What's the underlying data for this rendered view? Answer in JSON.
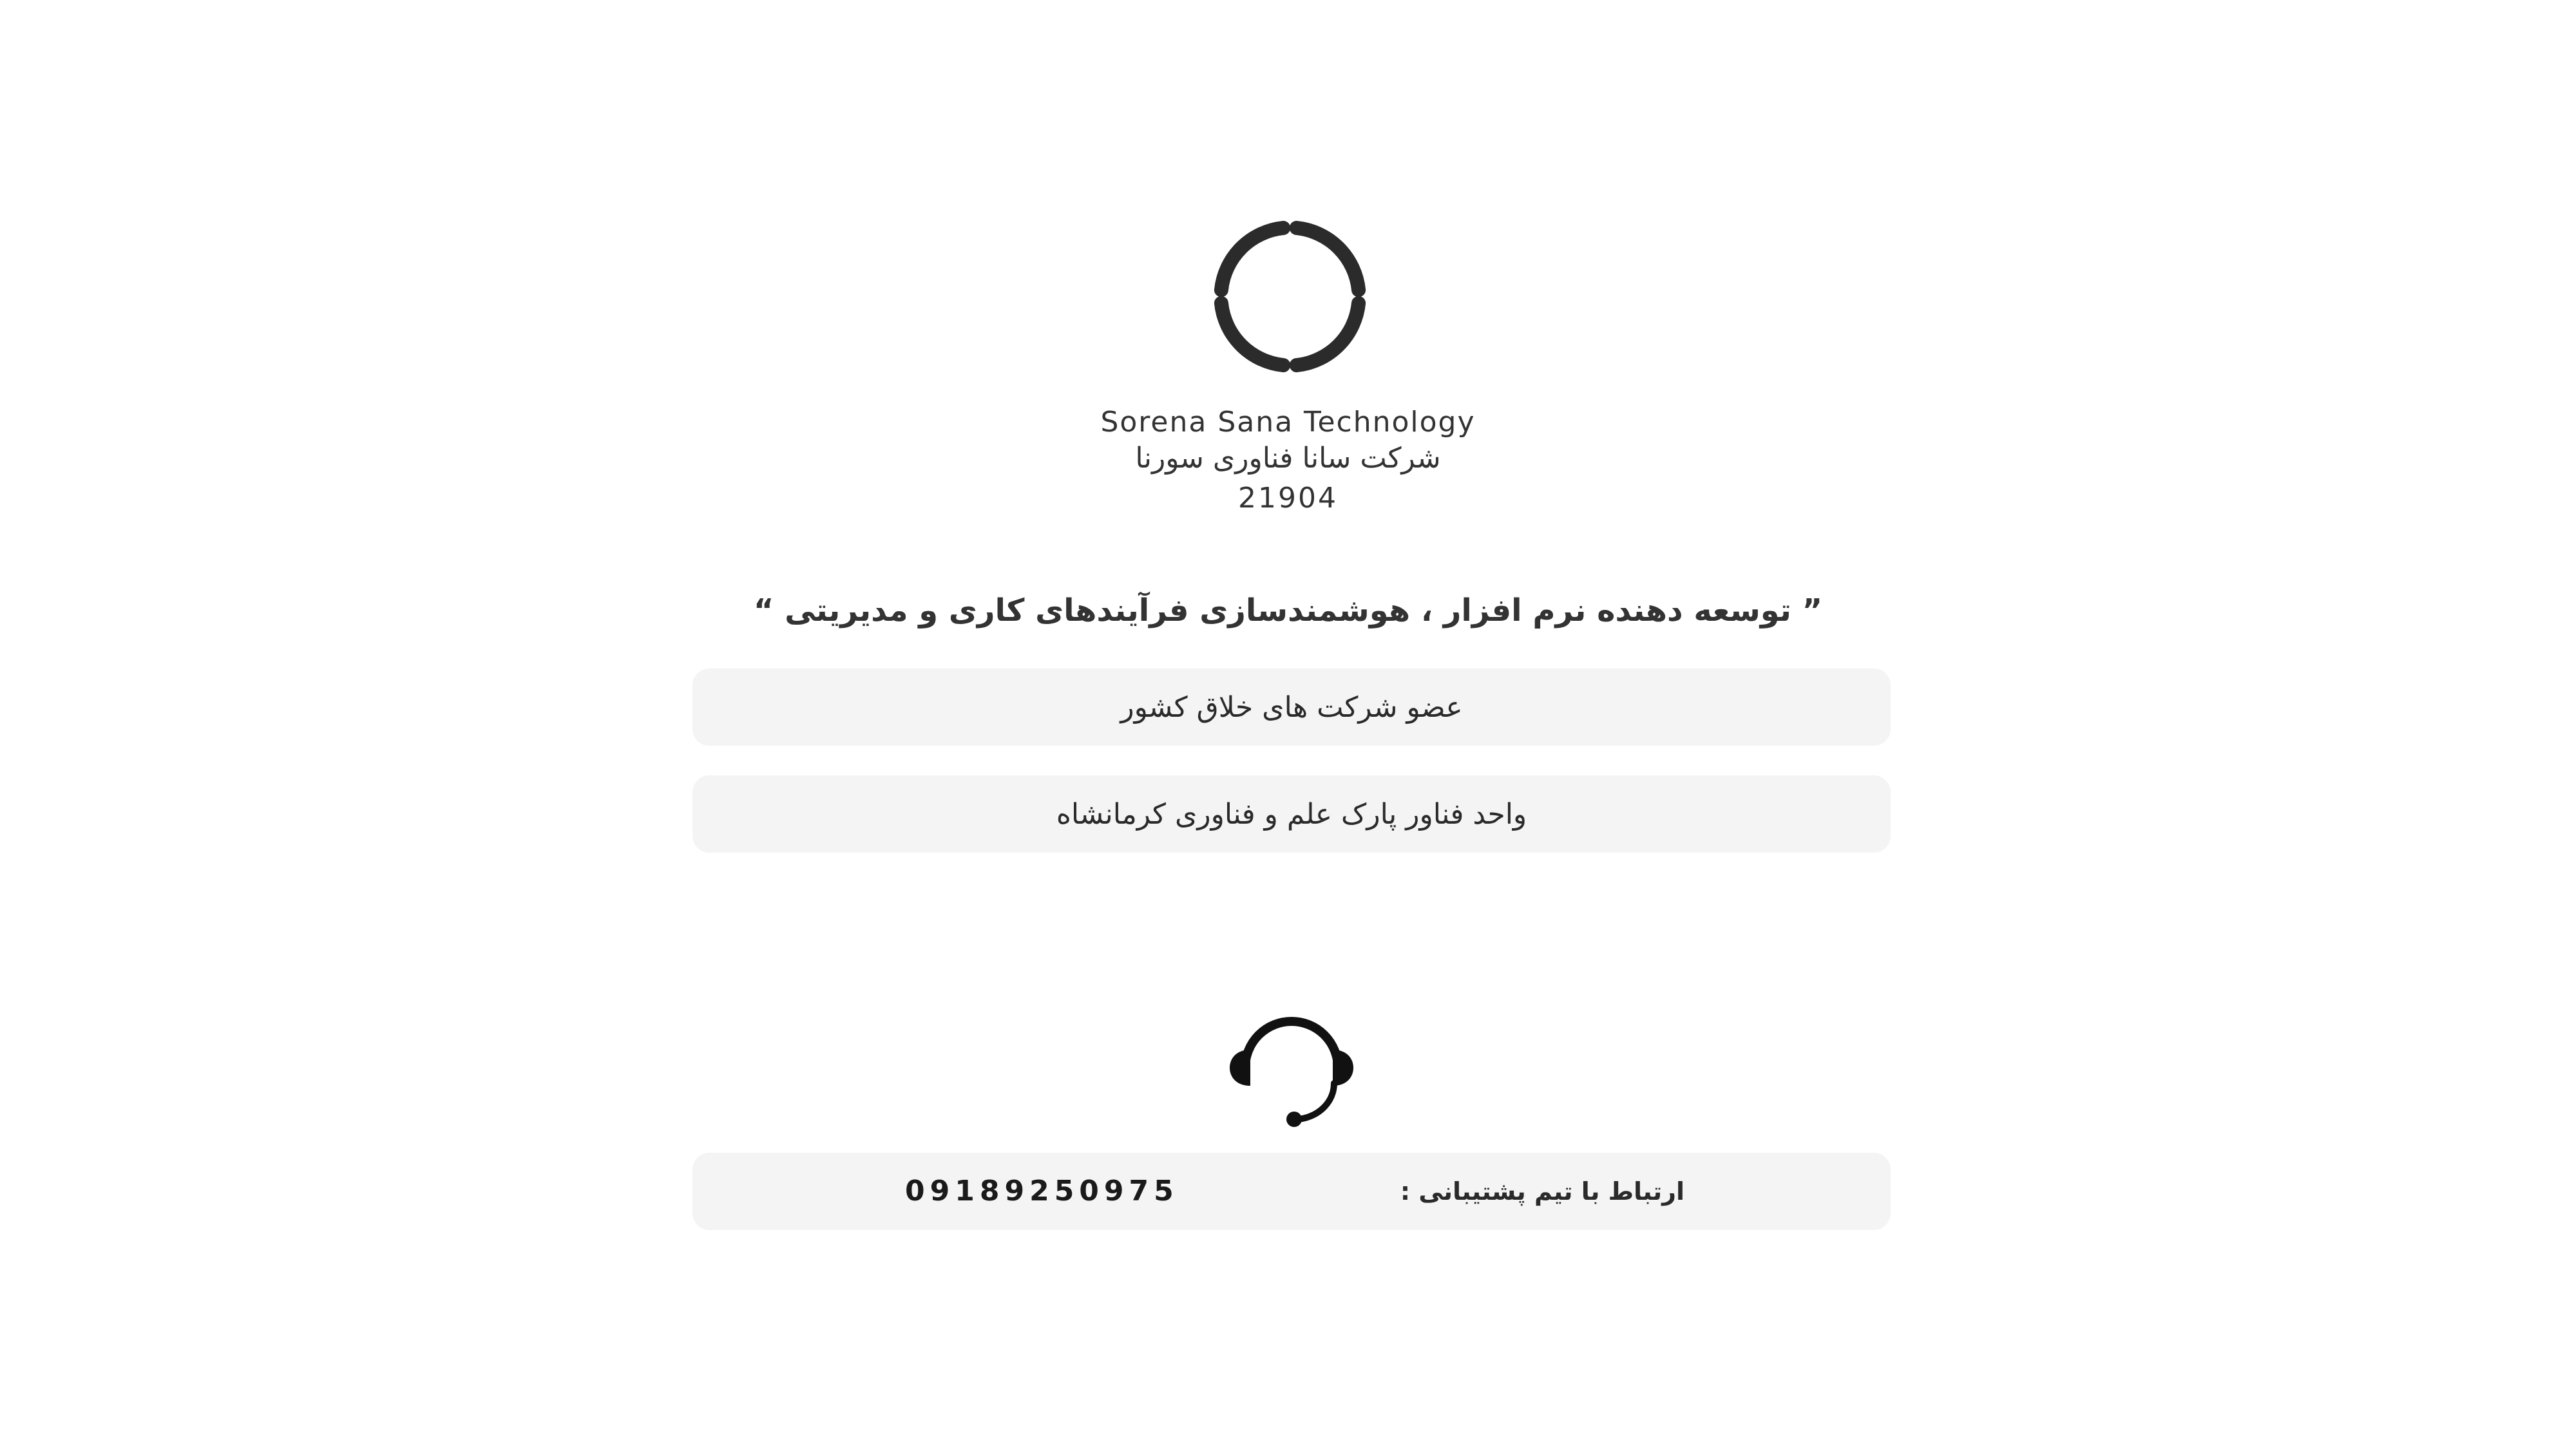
{
  "brand": {
    "name_en": "Sorena Sana Technology",
    "name_fa": "شرکت سانا فناوری سورنا",
    "code": "21904",
    "logo_icon": "circle-segments-logo-icon"
  },
  "tagline": "” توسعه دهنده نرم افزار ، هوشمندسازی فرآیندهای کاری و مدیریتی “",
  "badges": [
    {
      "label": "عضو شرکت های خلاق کشور"
    },
    {
      "label": "واحد فناور پارک علم و فناوری کرمانشاه"
    }
  ],
  "support": {
    "icon": "headset-icon",
    "label": "ارتباط با تیم پشتیبانی :",
    "phone": "09189250975"
  },
  "colors": {
    "background": "#ffffff",
    "card": "#f4f4f4",
    "text": "#2a2a2a",
    "icon": "#2b2b2b"
  }
}
